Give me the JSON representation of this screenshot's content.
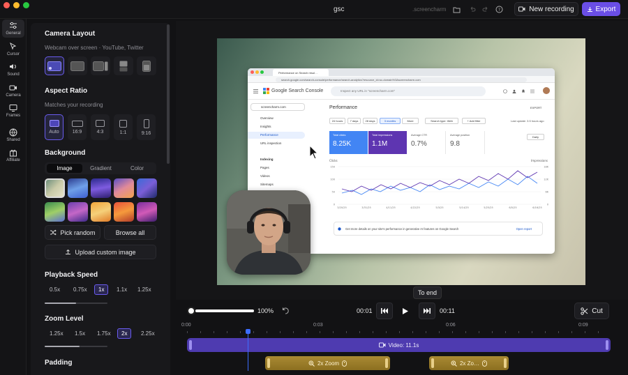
{
  "window": {
    "title": "gsc",
    "project_name": ".screencharm"
  },
  "toolbar": {
    "new_recording_label": "New recording",
    "export_label": "Export"
  },
  "rail": [
    {
      "label": "General",
      "icon": "sliders-icon"
    },
    {
      "label": "Cursor",
      "icon": "cursor-icon"
    },
    {
      "label": "Sound",
      "icon": "speaker-icon"
    },
    {
      "label": "Camera",
      "icon": "camera-icon"
    },
    {
      "label": "Frames",
      "icon": "monitor-icon"
    },
    {
      "label": "Shared",
      "icon": "globe-icon"
    },
    {
      "label": "Affiliate",
      "icon": "gift-icon"
    }
  ],
  "camera_layout": {
    "title": "Camera Layout",
    "subtitle": "Webcam over screen · YouTube, Twitter"
  },
  "aspect_ratio": {
    "title": "Aspect Ratio",
    "subtitle": "Matches your recording",
    "options": [
      "Auto",
      "16:9",
      "4:3",
      "1:1",
      "9:16"
    ],
    "selected": "Auto"
  },
  "background": {
    "title": "Background",
    "tabs": [
      "Image",
      "Gradient",
      "Color"
    ],
    "selected_tab": "Image",
    "pick_random_label": "Pick random",
    "browse_all_label": "Browse all",
    "upload_label": "Upload custom image"
  },
  "playback_speed": {
    "title": "Playback Speed",
    "options": [
      "0.5x",
      "0.75x",
      "1x",
      "1.1x",
      "1.25x"
    ],
    "selected": "1x",
    "level": 0.5
  },
  "zoom_level": {
    "title": "Zoom Level",
    "options": [
      "1.25x",
      "1.5x",
      "1.75x",
      "2x",
      "2.25x"
    ],
    "selected": "2x",
    "level": 0.56
  },
  "padding": {
    "title": "Padding"
  },
  "preview": {
    "browser": {
      "tab_title": "Performance on Search resul…",
      "url": "search.google.com/search-console/performance/search-analytics?resource_id=sc-domain%3Ascreencharm.com",
      "app_name": "Google Search Console",
      "search_placeholder": "Inspect any URL in \"screencharm.com\"",
      "property": "screencharm.com",
      "nav": [
        "Overview",
        "Insights",
        "Performance",
        "URL inspection"
      ],
      "indexing_header": "Indexing",
      "indexing_items": [
        "Pages",
        "Videos",
        "Sitemaps"
      ],
      "page_title": "Performance",
      "export_label": "EXPORT",
      "filters": [
        "24 hours",
        "7 days",
        "28 days",
        "3 months",
        "More"
      ],
      "selected_filter": "3 months",
      "search_type": "Search type: Web",
      "add_filter": "+ Add filter",
      "last_update": "Last update: 3.5 hours ago",
      "metrics": [
        {
          "label": "Total clicks",
          "value": "8.25K"
        },
        {
          "label": "Total impressions",
          "value": "1.1M"
        },
        {
          "label": "Average CTR",
          "value": "0.7%"
        },
        {
          "label": "Average position",
          "value": "9.8"
        }
      ],
      "daily_label": "Daily",
      "chart_left_label": "Clicks",
      "chart_right_label": "Impressions",
      "y_left": [
        "150",
        "100",
        "50",
        "0"
      ],
      "y_right": [
        "18K",
        "12K",
        "6K",
        "0"
      ],
      "x_dates": [
        "3/20/25",
        "3/31/25",
        "4/11/25",
        "4/22/25",
        "5/3/25",
        "5/14/25",
        "5/25/25",
        "6/5/25",
        "6/16/25"
      ],
      "banner_text": "Get more details on your site's performance in generative AI features on Google Search",
      "banner_link": "Open report"
    }
  },
  "tooltip": "To end",
  "transport": {
    "volume": "100%",
    "current_time": "00:01",
    "end_time": "00:11",
    "cut_label": "Cut",
    "volume_level": 1.0
  },
  "timeline": {
    "ticks": [
      "0:00",
      "0:03",
      "0:06",
      "0:09"
    ],
    "video_clip": "Video: 11.1s",
    "zoom_clips": [
      "2x Zoom",
      "2x Zo…"
    ]
  }
}
